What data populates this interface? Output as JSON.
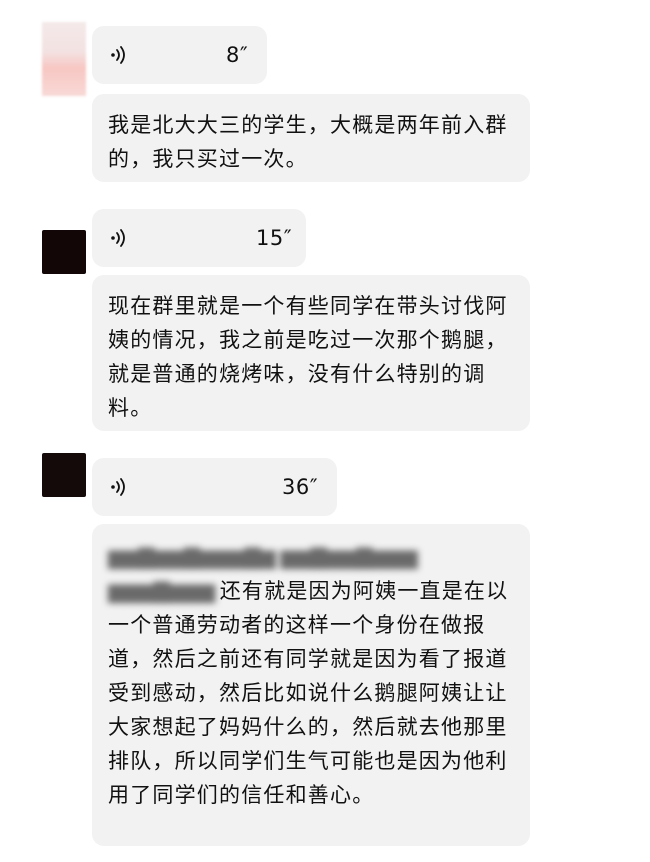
{
  "messages": [
    {
      "voice_duration": "8″",
      "text": "我是北大大三的学生，大概是两年前入群的，我只买过一次。"
    },
    {
      "voice_duration": "15″",
      "text": "现在群里就是一个有些同学在带头讨伐阿姨的情况，我之前是吃过一次那个鹅腿，就是普通的烧烤味，没有什么特别的调料。"
    },
    {
      "voice_duration": "36″",
      "blurred_text": "（文字已打码）",
      "text": "还有就是因为阿姨一直是在以一个普通劳动者的这样一个身份在做报道，然后之前还有同学就是因为看了报道受到感动，然后比如说什么鹅腿阿姨让让大家想起了妈妈什么的，然后就去他那里排队，所以同学们生气可能也是因为他利用了同学们的信任和善心。"
    }
  ],
  "icons": {
    "voice": "voice-wave-icon"
  },
  "colors": {
    "bubble": "#f2f2f2",
    "text": "#111111",
    "background": "#ffffff"
  }
}
